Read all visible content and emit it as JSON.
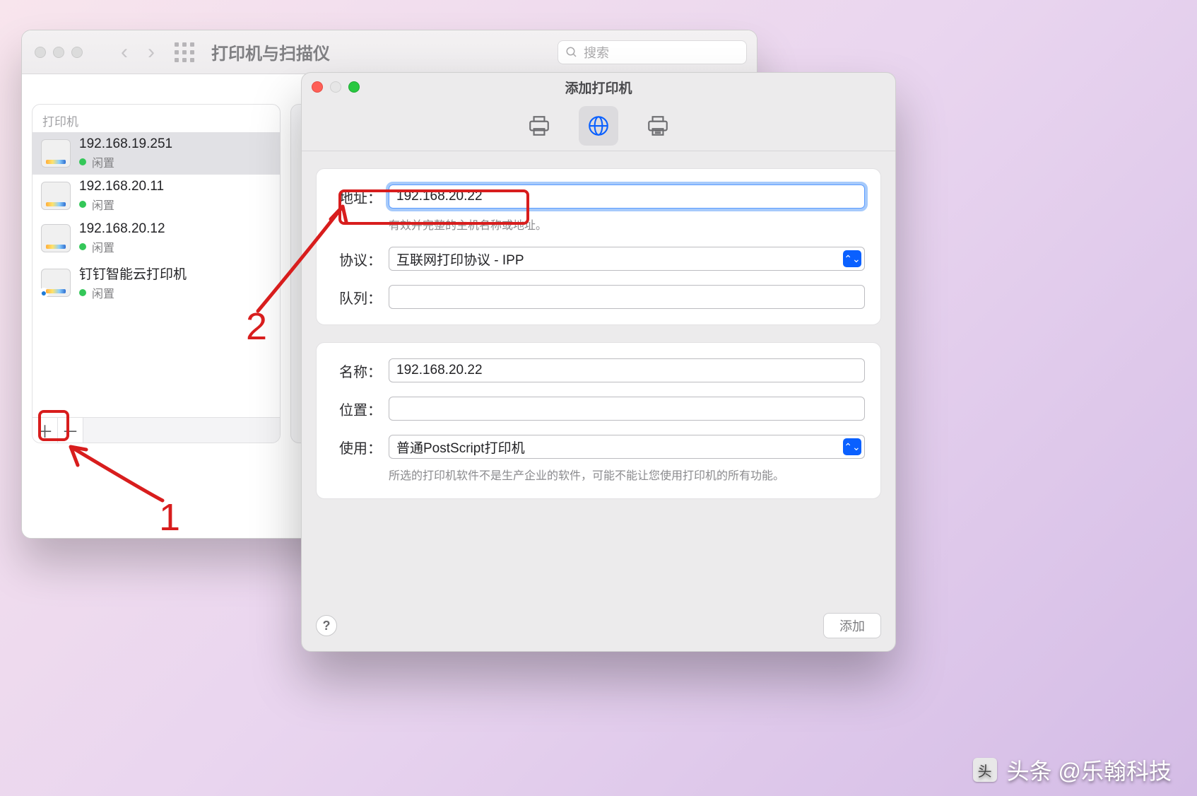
{
  "prefs": {
    "title": "打印机与扫描仪",
    "search_placeholder": "搜索",
    "sidebar_header": "打印机",
    "printers": [
      {
        "name": "192.168.19.251",
        "status": "闲置"
      },
      {
        "name": "192.168.20.11",
        "status": "闲置"
      },
      {
        "name": "192.168.20.12",
        "status": "闲置"
      },
      {
        "name": "钉钉智能云打印机",
        "status": "闲置"
      }
    ],
    "add_symbol": "＋",
    "remove_symbol": "－"
  },
  "add": {
    "title": "添加打印机",
    "labels": {
      "address": "地址：",
      "protocol": "协议：",
      "queue": "队列：",
      "name": "名称：",
      "location": "位置：",
      "use": "使用："
    },
    "address_value": "192.168.20.22",
    "address_hint": "有效并完整的主机名称或地址。",
    "protocol_value": "互联网打印协议 - IPP",
    "queue_value": "",
    "name_value": "192.168.20.22",
    "location_value": "",
    "use_value": "普通PostScript打印机",
    "use_hint": "所选的打印机软件不是生产企业的软件，可能不能让您使用打印机的所有功能。",
    "help": "?",
    "submit": "添加"
  },
  "annotations": {
    "one": "1",
    "two": "2"
  },
  "watermark": {
    "text": "头条 @乐翰科技"
  }
}
